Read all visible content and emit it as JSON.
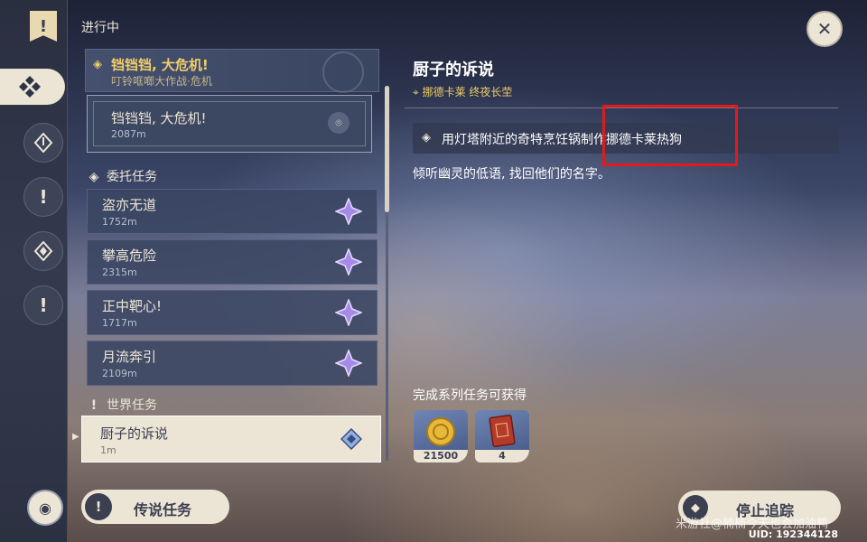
{
  "header": {
    "in_progress_label": "进行中"
  },
  "featured_quest": {
    "title": "铛铛铛, 大危机!",
    "subtitle": "叮铃哐啷大作战·危机"
  },
  "sub_quest": {
    "title": "铛铛铛, 大危机!",
    "distance": "2087m"
  },
  "commissions": {
    "section_label": "委托任务",
    "items": [
      {
        "title": "盗亦无道",
        "distance": "1752m"
      },
      {
        "title": "攀高危险",
        "distance": "2315m"
      },
      {
        "title": "正中靶心!",
        "distance": "1717m"
      },
      {
        "title": "月流奔引",
        "distance": "2109m"
      }
    ]
  },
  "world_quests": {
    "section_label": "世界任务",
    "items": [
      {
        "title": "厨子的诉说",
        "distance": "1m"
      }
    ]
  },
  "legend_button": {
    "label": "传说任务"
  },
  "detail": {
    "title": "厨子的诉说",
    "location": "挪德卡莱 终夜长茔",
    "objective": "用灯塔附近的奇特烹饪锅制作挪德卡莱热狗",
    "description": "倾听幽灵的低语, 找回他们的名字。"
  },
  "rewards": {
    "label": "完成系列任务可获得",
    "items": [
      {
        "icon": "mora-coin-icon",
        "count": "21500"
      },
      {
        "icon": "red-book-icon",
        "count": "4"
      }
    ]
  },
  "stop_button": {
    "label": "停止追踪"
  },
  "uid": "UID: 192344128",
  "watermark": "米游社@楠楠今天也会加油鸭",
  "colors": {
    "accent_gold": "#f0cd6a",
    "panel": "#3a4560",
    "cream": "#ece5d6",
    "highlight_red": "#e11b1b"
  }
}
